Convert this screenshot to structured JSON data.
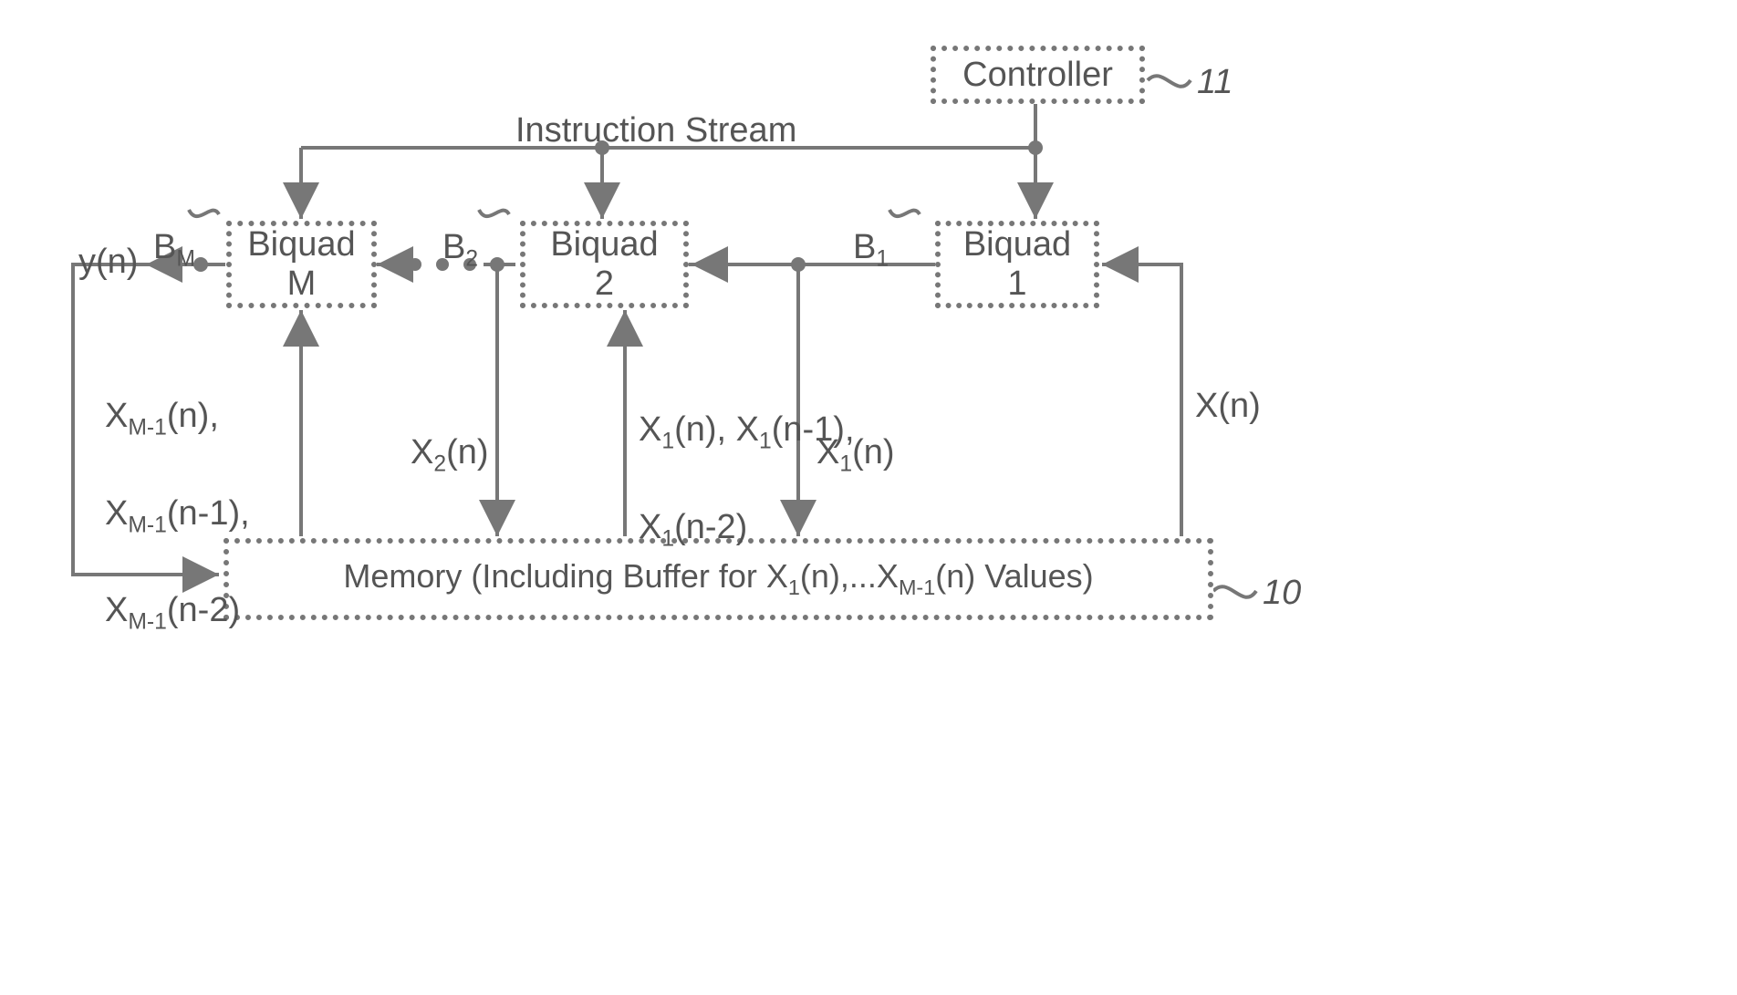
{
  "blocks": {
    "controller": "Controller",
    "biquad1": "Biquad\n1",
    "biquad2": "Biquad\n2",
    "biquadM": "Biquad\nM",
    "memory_prefix": "Memory (Including Buffer for X",
    "memory_mid": "(n),...X",
    "memory_suffix": "(n) Values)",
    "memory_sub1": "1",
    "memory_sub2": "M-1"
  },
  "labels": {
    "instruction_stream": "Instruction Stream",
    "yn": "y(n)",
    "xn": "X(n)",
    "x1n_down": "X",
    "x1n_down_sub": "1",
    "x1n_down_tail": "(n)",
    "x2n": "X",
    "x2n_sub": "2",
    "x2n_tail": "(n)",
    "x1series_l1_a": "X",
    "x1series_l1_asub": "1",
    "x1series_l1_b": "(n), X",
    "x1series_l1_bsub": "1",
    "x1series_l1_c": "(n-1),",
    "x1series_l2_a": "X",
    "x1series_l2_asub": "1",
    "x1series_l2_b": "(n-2)",
    "xm1_l1_a": "X",
    "xm1_l1_asub": "M-1",
    "xm1_l1_b": "(n),",
    "xm1_l2_a": "X",
    "xm1_l2_asub": "M-1",
    "xm1_l2_b": "(n-1),",
    "xm1_l3_a": "X",
    "xm1_l3_asub": "M-1",
    "xm1_l3_b": "(n-2)",
    "ref11": "11",
    "ref10": "10",
    "b1_a": "B",
    "b1_sub": "1",
    "b2_a": "B",
    "b2_sub": "2",
    "bm_a": "B",
    "bm_sub": "M"
  }
}
